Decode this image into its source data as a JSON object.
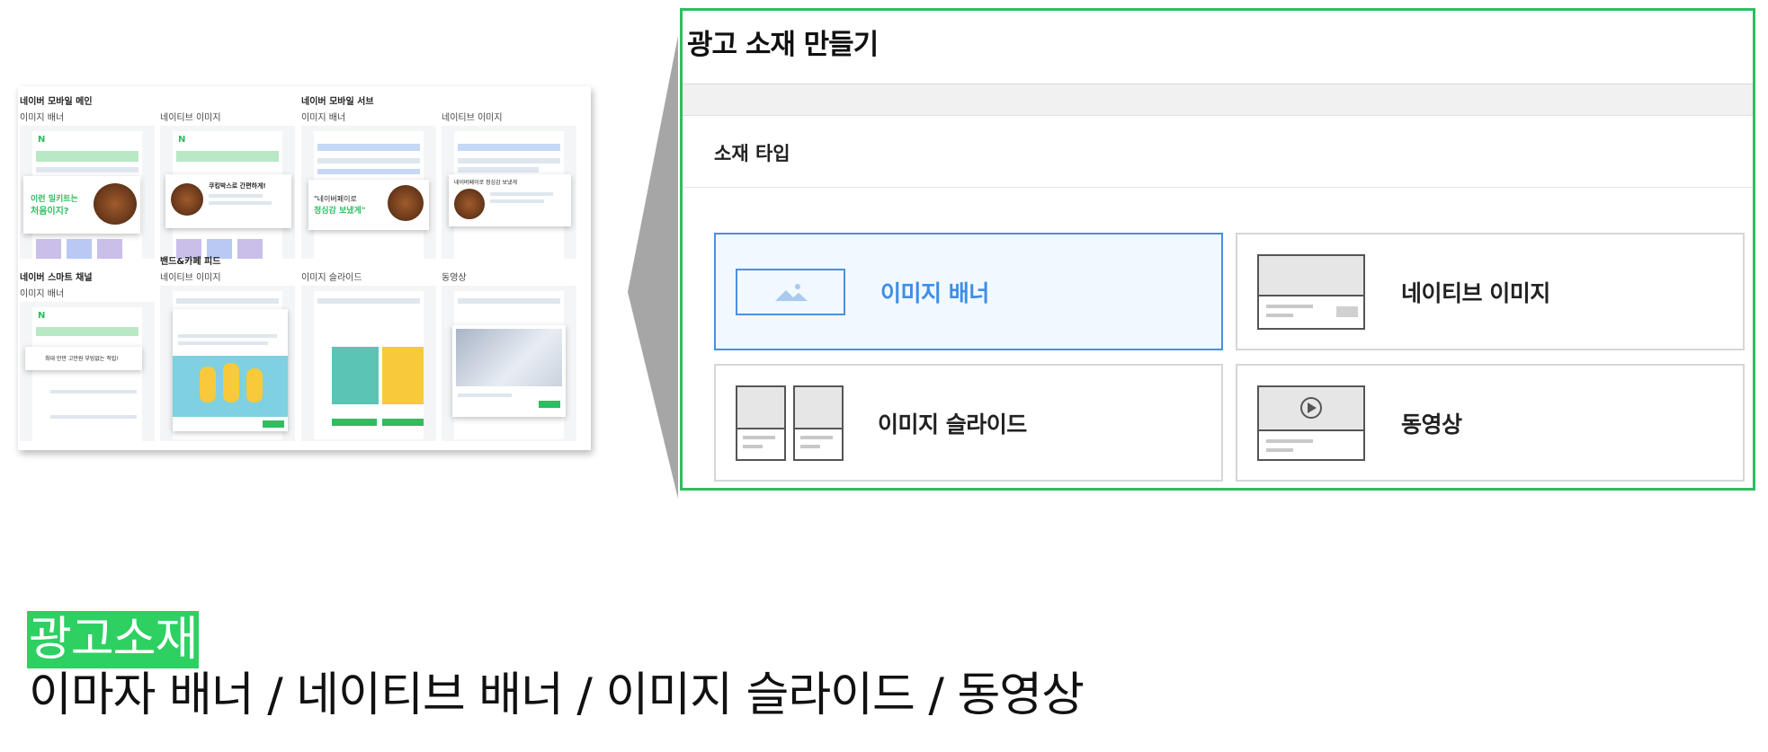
{
  "preview": {
    "cells": [
      {
        "title": "네이버 모바일 메인",
        "subtitle": "이미지 배너"
      },
      {
        "title": "",
        "subtitle": "네이티브 이미지"
      },
      {
        "title": "네이버 모바일 서브",
        "subtitle": "이미지 배너"
      },
      {
        "title": "",
        "subtitle": "네이티브 이미지"
      },
      {
        "title": "네이버 스마트 채널",
        "subtitle": "이미지 배너"
      },
      {
        "title": "밴드&카페 피드",
        "subtitle": "네이티브 이미지"
      },
      {
        "title": "",
        "subtitle": "이미지 슬라이드"
      },
      {
        "title": "",
        "subtitle": "동영상"
      }
    ],
    "card_texts": {
      "main_banner_line1": "이런 밀키트는",
      "main_banner_line2": "처음이지?",
      "native_card": "쿠킹박스로 간편하게!",
      "sub_banner_line1": "\"네이버페이로",
      "sub_banner_line2": "정심감 보냈게\"",
      "sub_native": "네이버페이로 정심감 보냈게",
      "smart_channel": "최대 만만 고만원 부빙없는 적립!"
    }
  },
  "builder": {
    "title": "광고 소재 만들기",
    "section_label": "소재 타입",
    "options": [
      {
        "label": "이미지 배너",
        "selected": true,
        "icon": "image-banner-icon"
      },
      {
        "label": "네이티브 이미지",
        "selected": false,
        "icon": "native-image-icon"
      },
      {
        "label": "이미지 슬라이드",
        "selected": false,
        "icon": "image-slide-icon"
      },
      {
        "label": "동영상",
        "selected": false,
        "icon": "video-icon"
      }
    ]
  },
  "caption": {
    "highlight": "광고소재",
    "line": "이마자 배너 / 네이티브 배너 / 이미지 슬라이드 / 동영상"
  },
  "colors": {
    "accent_green": "#2dbe60",
    "selected_blue": "#3d8ee6",
    "caption_highlight": "#2ed062"
  }
}
